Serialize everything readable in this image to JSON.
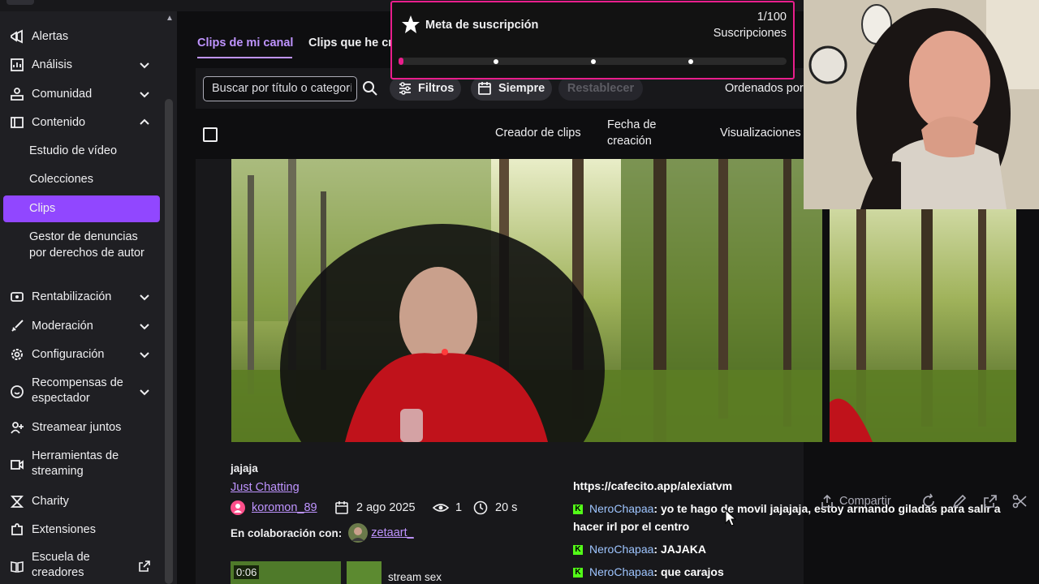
{
  "sidebar": {
    "items": [
      {
        "label": "Alertas",
        "icon": "alert-icon",
        "chevron": false
      },
      {
        "label": "Análisis",
        "icon": "chart-icon",
        "chevron": "down"
      },
      {
        "label": "Comunidad",
        "icon": "community-icon",
        "chevron": "down"
      },
      {
        "label": "Contenido",
        "icon": "content-icon",
        "chevron": "up"
      },
      {
        "label": "Rentabilización",
        "icon": "money-icon",
        "chevron": "down"
      },
      {
        "label": "Moderación",
        "icon": "sword-icon",
        "chevron": "down"
      },
      {
        "label": "Configuración",
        "icon": "gear-icon",
        "chevron": "down"
      },
      {
        "label": "Recompensas de espectador",
        "icon": "reward-icon",
        "chevron": "down"
      },
      {
        "label": "Streamear juntos",
        "icon": "users-plus-icon",
        "chevron": false
      },
      {
        "label": "Herramientas de streaming",
        "icon": "camera-icon",
        "chevron": false
      },
      {
        "label": "Charity",
        "icon": "charity-icon",
        "chevron": false
      },
      {
        "label": "Extensiones",
        "icon": "puzzle-icon",
        "chevron": false
      },
      {
        "label": "Escuela de creadores",
        "icon": "book-icon",
        "chevron": false
      }
    ],
    "content_subitems": [
      {
        "label": "Estudio de vídeo"
      },
      {
        "label": "Colecciones"
      },
      {
        "label": "Clips"
      },
      {
        "label": "Gestor de denuncias por derechos de autor"
      }
    ]
  },
  "tabs": {
    "mine": "Clips de mi canal",
    "other": "Clips que he cr"
  },
  "toolbar": {
    "search_placeholder": "Buscar por título o categoría",
    "filters": "Filtros",
    "period": "Siempre",
    "reset": "Restablecer",
    "sort": "Ordenados por"
  },
  "columns": {
    "creator": "Creador de clips",
    "date": "Fecha de creación",
    "views": "Visualizaciones"
  },
  "goal": {
    "title": "Meta de suscripción",
    "count": "1/100",
    "unit": "Suscripciones",
    "progress": 0.01
  },
  "clip": {
    "title": "jajaja",
    "category": "Just Chatting",
    "creator": "koromon_89",
    "date": "2 ago 2025",
    "views": "1",
    "duration": "20 s",
    "collab_label": "En colaboración con:",
    "collab_user": "zetaart_",
    "share": "Compartir"
  },
  "chat": {
    "donation_link": "https://cafecito.app/alexiatvm",
    "messages": [
      {
        "user": "NeroChapaa",
        "text": ": yo te hago de movil jajajaja, estoy armando giladas para salir a hacer irl por el centro"
      },
      {
        "user": "NeroChapaa",
        "text": ": JAJAKA"
      },
      {
        "user": "NeroChapaa",
        "text": ": que carajos"
      }
    ]
  },
  "next_clip": {
    "duration": "0:06",
    "title": "stream sex"
  },
  "colors": {
    "accent": "#9147ff",
    "accent_text": "#bf94ff",
    "goal_border": "#e91e8c",
    "kick_green": "#53fc18"
  }
}
